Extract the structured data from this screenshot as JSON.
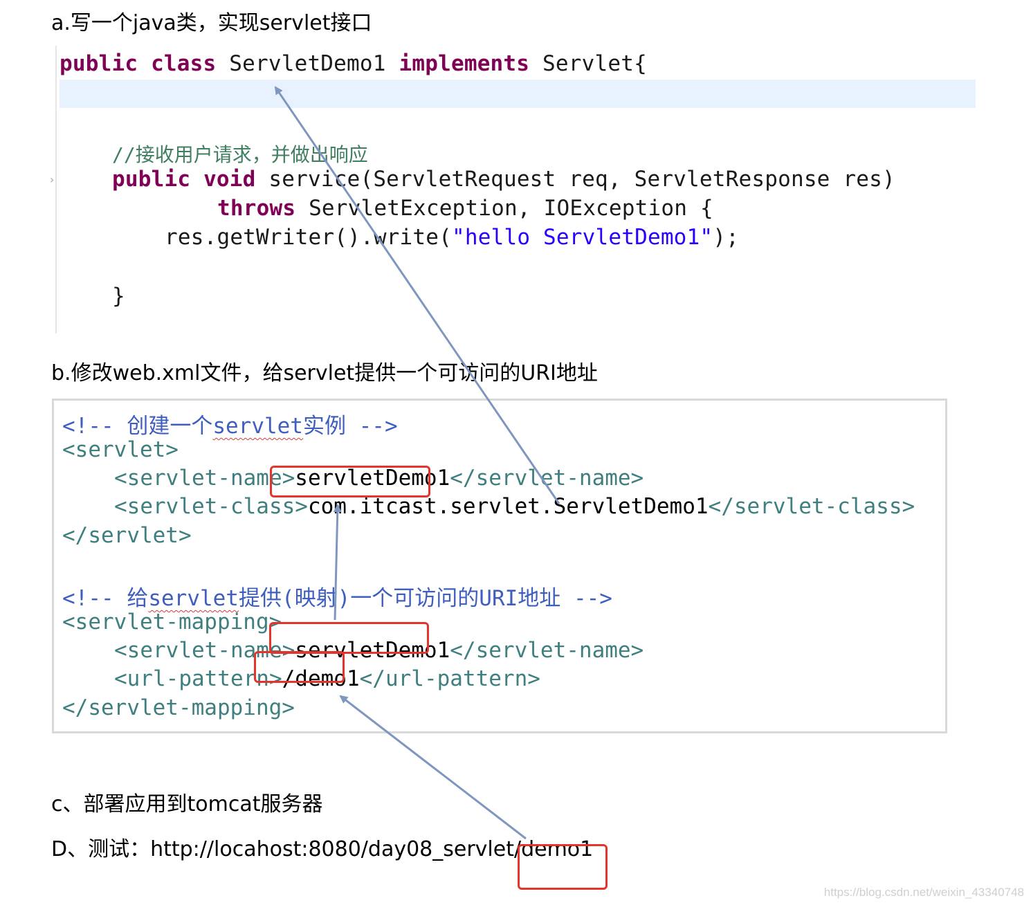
{
  "headings": {
    "a": "a.写一个java类，实现servlet接口",
    "b": "b.修改web.xml文件，给servlet提供一个可访问的URI地址",
    "c": "c、部署应用到tomcat服务器",
    "d": "D、测试：http://locahost:8080/day08_servlet/demo1"
  },
  "java": {
    "l1_kw1": "public",
    "l1_kw2": "class",
    "l1_name": "ServletDemo1",
    "l1_kw3": "implements",
    "l1_rest": "Servlet{",
    "comment": "//接收用户请求，并做出响应",
    "l2_kw1": "public",
    "l2_kw2": "void",
    "l2_rest": "service(ServletRequest req, ServletResponse res)",
    "l3_kw": "throws",
    "l3_rest": "ServletException, IOException {",
    "l4_pre": "res.getWriter().write(",
    "l4_str": "\"hello ServletDemo1\"",
    "l4_post": ");",
    "l5": "}"
  },
  "xml": {
    "cmt1_pre": "<!-- 创建一个",
    "cmt1_word": "servlet",
    "cmt1_post": "实例 -->",
    "servlet_open": "<servlet>",
    "name_open": "<servlet-name>",
    "name_val": "servletDemo1",
    "name_close": "</servlet-name>",
    "class_open": "<servlet-class>",
    "class_val": "com.itcast.servlet.ServletDemo1",
    "class_close": "</servlet-class>",
    "servlet_close": "</servlet>",
    "cmt2_pre": "<!-- 给",
    "cmt2_word": "servlet",
    "cmt2_post": "提供(映射)一个可访问的URI地址 -->",
    "mapping_open": "<servlet-mapping>",
    "mname_open": "<servlet-name>",
    "mname_val": "servletDemo1",
    "mname_close": "</servlet-name>",
    "url_open": "<url-pattern>",
    "url_val": "/demo1",
    "url_close": "</url-pattern>",
    "mapping_close": "</servlet-mapping>"
  },
  "watermark": "https://blog.csdn.net/weixin_43340748",
  "colors": {
    "keyword": "#7f0055",
    "string": "#2a00ff",
    "java_comment": "#3f7f5f",
    "xml_tag": "#3f7f7f",
    "xml_comment": "#3f5fbf",
    "highlight_box": "#e3352b",
    "arrow": "#7f97bf"
  }
}
